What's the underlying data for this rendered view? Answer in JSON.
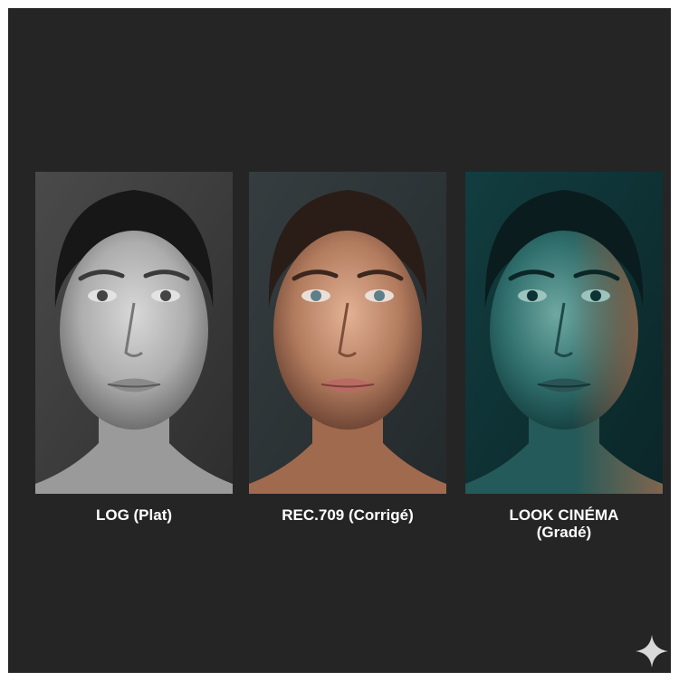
{
  "panels": [
    {
      "caption_lines": [
        "LOG (Plat)"
      ],
      "colors": {
        "bg": "#3f3f3f",
        "skin": "#b0b0b0",
        "skin_light": "#d4d4d4",
        "hair": "#1a1a1a",
        "lips": "#8d8d8d",
        "shadow": "#4a4a4a"
      }
    },
    {
      "caption_lines": [
        "REC.709 (Corrigé)"
      ],
      "colors": {
        "bg": "#2c3336",
        "skin": "#b27b5e",
        "skin_light": "#dba98c",
        "hair": "#2a1d17",
        "lips": "#b76b63",
        "shadow": "#5b3a2c"
      }
    },
    {
      "caption_lines": [
        "LOOK CINÉMA",
        "(Gradé)"
      ],
      "colors": {
        "bg": "#0f3537",
        "skin": "#2f6e6c",
        "skin_light": "#76a9a3",
        "hair": "#0a1c1e",
        "lips": "#2a5455",
        "shadow": "#123a3b",
        "warm": "#a86a4a"
      }
    }
  ],
  "watermark": {
    "icon": "sparkle-icon",
    "color": "#d9d9d9"
  }
}
